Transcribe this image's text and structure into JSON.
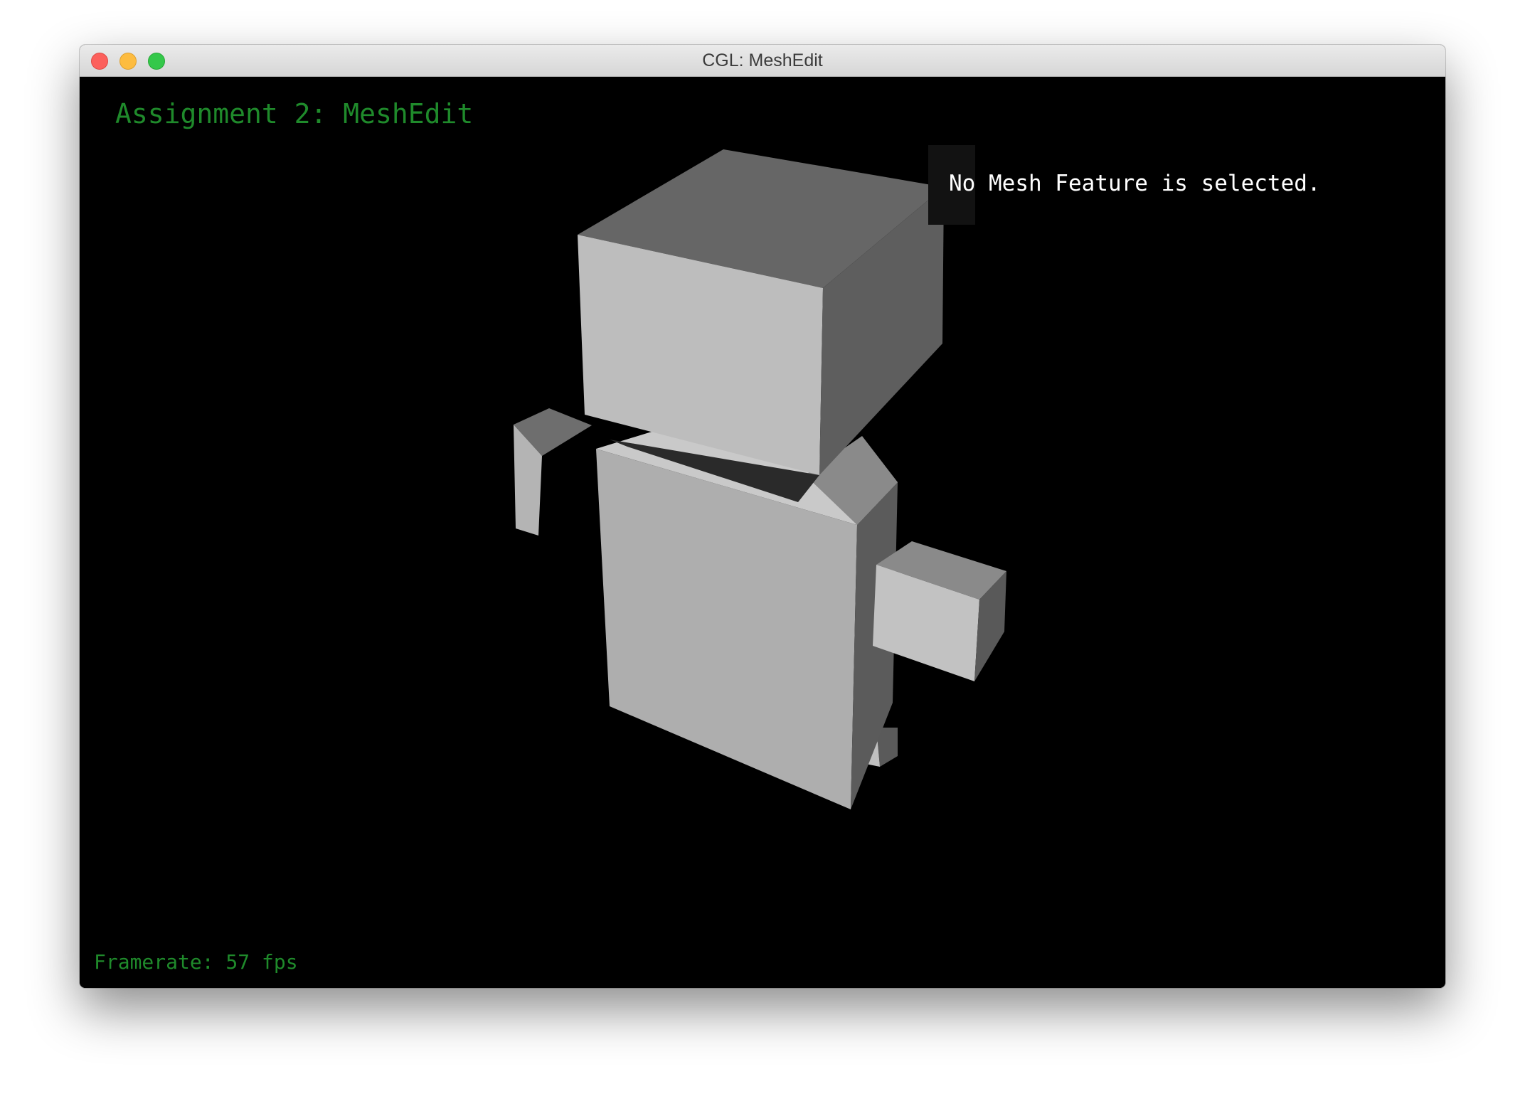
{
  "window": {
    "title": "CGL: MeshEdit"
  },
  "hud": {
    "assignment_title": "Assignment 2: MeshEdit",
    "selection_info": "No Mesh Feature is selected.",
    "framerate": "Framerate: 57 fps"
  },
  "colors": {
    "hud_text": "#1f8a2b",
    "info_text": "#ffffff",
    "background": "#000000",
    "info_box": "#121212"
  }
}
